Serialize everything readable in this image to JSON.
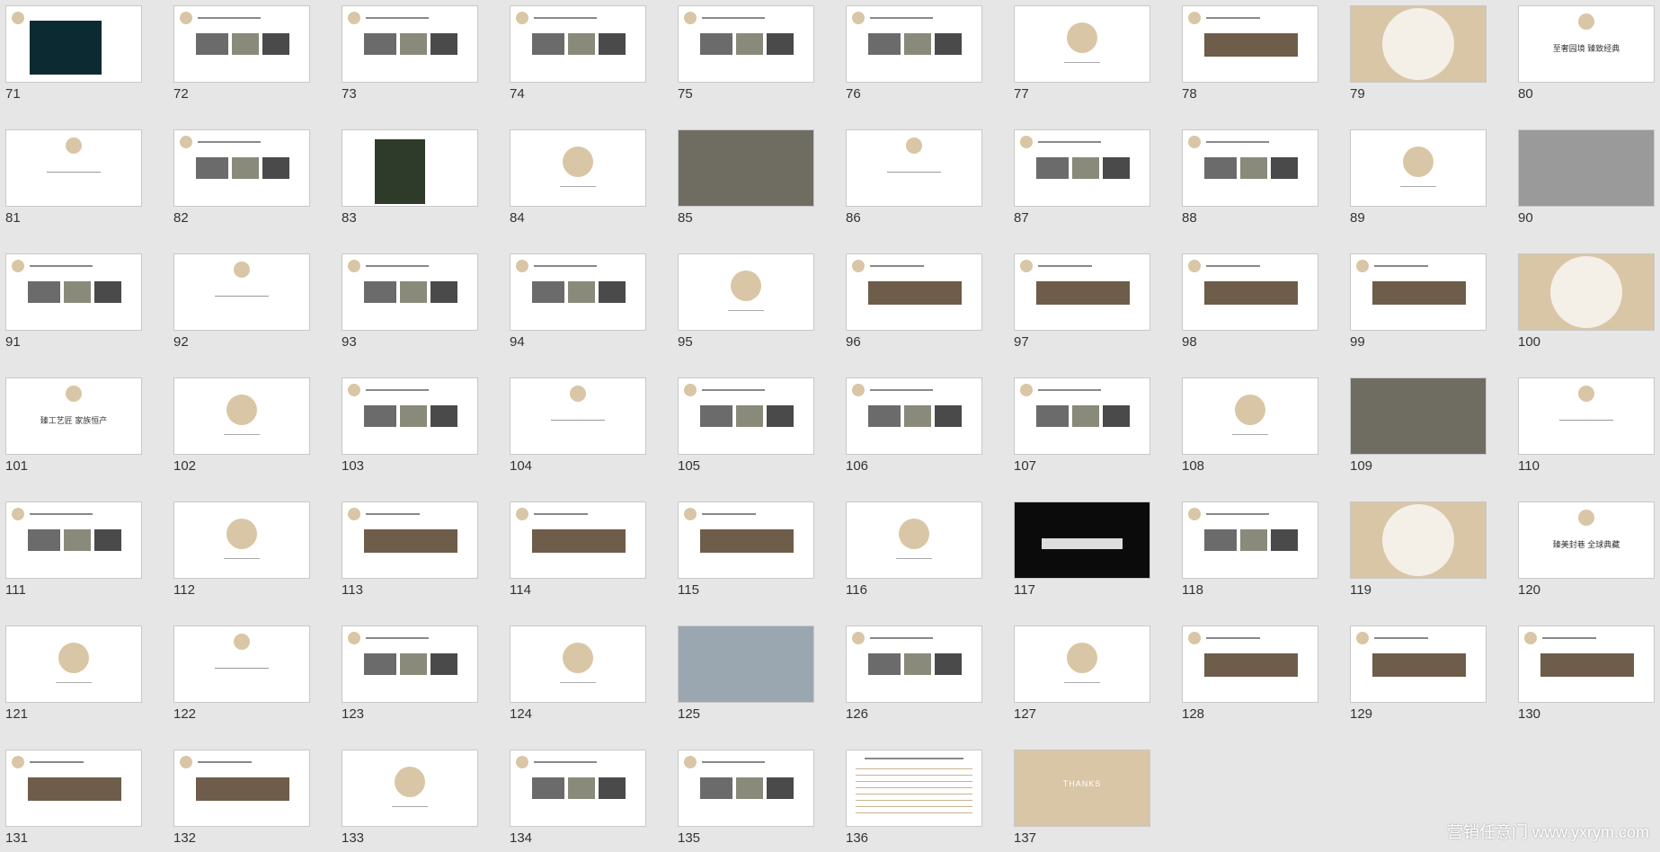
{
  "slides": [
    {
      "n": "71",
      "kind": "dark-photo"
    },
    {
      "n": "72",
      "kind": "text-photos"
    },
    {
      "n": "73",
      "kind": "text-photos"
    },
    {
      "n": "74",
      "kind": "text-photos"
    },
    {
      "n": "75",
      "kind": "text-photos"
    },
    {
      "n": "76",
      "kind": "text-photos"
    },
    {
      "n": "77",
      "kind": "circle"
    },
    {
      "n": "78",
      "kind": "photo-strip"
    },
    {
      "n": "79",
      "kind": "beige-circle"
    },
    {
      "n": "80",
      "kind": "title-circle",
      "text": "至奢园境 臻致经典"
    },
    {
      "n": "81",
      "kind": "title-circle"
    },
    {
      "n": "82",
      "kind": "text-photos"
    },
    {
      "n": "83",
      "kind": "center-photo"
    },
    {
      "n": "84",
      "kind": "circle"
    },
    {
      "n": "85",
      "kind": "full-photo"
    },
    {
      "n": "86",
      "kind": "title-circle"
    },
    {
      "n": "87",
      "kind": "text-photos"
    },
    {
      "n": "88",
      "kind": "text-photos"
    },
    {
      "n": "89",
      "kind": "circle"
    },
    {
      "n": "90",
      "kind": "grey-full"
    },
    {
      "n": "91",
      "kind": "text-photos"
    },
    {
      "n": "92",
      "kind": "title-circle"
    },
    {
      "n": "93",
      "kind": "text-photos"
    },
    {
      "n": "94",
      "kind": "text-photos"
    },
    {
      "n": "95",
      "kind": "circle"
    },
    {
      "n": "96",
      "kind": "photo-strip"
    },
    {
      "n": "97",
      "kind": "photo-strip"
    },
    {
      "n": "98",
      "kind": "photo-strip"
    },
    {
      "n": "99",
      "kind": "photo-strip"
    },
    {
      "n": "100",
      "kind": "beige-circle"
    },
    {
      "n": "101",
      "kind": "title-circle",
      "text": "臻工艺匠 家族恒产"
    },
    {
      "n": "102",
      "kind": "circle"
    },
    {
      "n": "103",
      "kind": "text-photos"
    },
    {
      "n": "104",
      "kind": "title-circle"
    },
    {
      "n": "105",
      "kind": "text-photos"
    },
    {
      "n": "106",
      "kind": "text-photos"
    },
    {
      "n": "107",
      "kind": "text-photos"
    },
    {
      "n": "108",
      "kind": "circle"
    },
    {
      "n": "109",
      "kind": "full-photo"
    },
    {
      "n": "110",
      "kind": "title-circle"
    },
    {
      "n": "111",
      "kind": "text-photos"
    },
    {
      "n": "112",
      "kind": "circle"
    },
    {
      "n": "113",
      "kind": "photo-strip"
    },
    {
      "n": "114",
      "kind": "photo-strip"
    },
    {
      "n": "115",
      "kind": "photo-strip"
    },
    {
      "n": "116",
      "kind": "circle"
    },
    {
      "n": "117",
      "kind": "black"
    },
    {
      "n": "118",
      "kind": "text-photos"
    },
    {
      "n": "119",
      "kind": "beige-circle"
    },
    {
      "n": "120",
      "kind": "title-circle",
      "text": "臻美封巷 全球典藏"
    },
    {
      "n": "121",
      "kind": "circle"
    },
    {
      "n": "122",
      "kind": "title-circle"
    },
    {
      "n": "123",
      "kind": "text-photos"
    },
    {
      "n": "124",
      "kind": "circle"
    },
    {
      "n": "125",
      "kind": "hall-photo"
    },
    {
      "n": "126",
      "kind": "text-photos"
    },
    {
      "n": "127",
      "kind": "circle"
    },
    {
      "n": "128",
      "kind": "photo-strip"
    },
    {
      "n": "129",
      "kind": "photo-strip"
    },
    {
      "n": "130",
      "kind": "photo-strip"
    },
    {
      "n": "131",
      "kind": "photo-strip"
    },
    {
      "n": "132",
      "kind": "photo-strip"
    },
    {
      "n": "133",
      "kind": "circle"
    },
    {
      "n": "134",
      "kind": "text-photos"
    },
    {
      "n": "135",
      "kind": "text-photos"
    },
    {
      "n": "136",
      "kind": "table"
    },
    {
      "n": "137",
      "kind": "thanks",
      "text": "THANKS"
    }
  ],
  "watermark": "营销任意门 www.yxrym.com"
}
